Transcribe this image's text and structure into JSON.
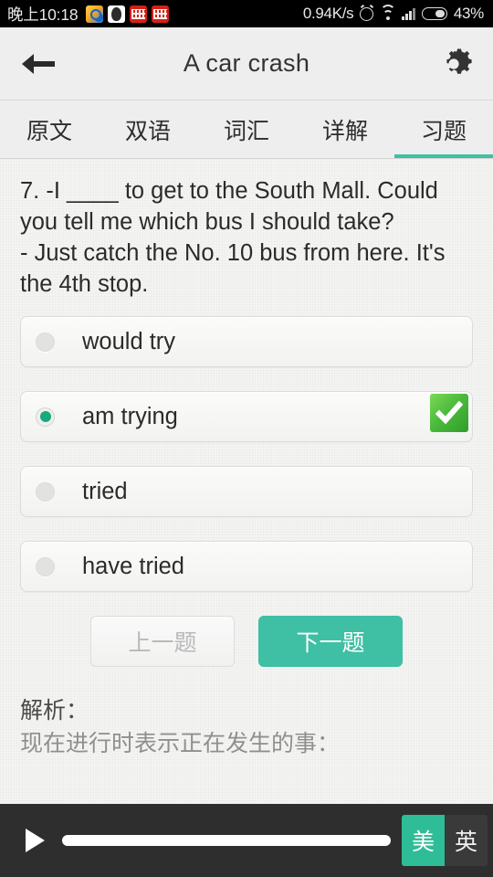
{
  "statusbar": {
    "clock": "晚上10:18",
    "app_icons": [
      "search-app-icon",
      "qq-app-icon",
      "red-app-icon-1",
      "red-app-icon-2"
    ],
    "network_speed": "0.94K/s",
    "icons": [
      "alarm-icon",
      "wifi-icon",
      "signal-icon",
      "battery-icon"
    ],
    "battery_percent": "43%"
  },
  "header": {
    "back_icon": "arrow-left-icon",
    "title": "A car crash",
    "settings_icon": "gear-icon"
  },
  "tabs": [
    {
      "label": "原文",
      "active": false
    },
    {
      "label": "双语",
      "active": false
    },
    {
      "label": "词汇",
      "active": false
    },
    {
      "label": "详解",
      "active": false
    },
    {
      "label": "习题",
      "active": true
    }
  ],
  "question": {
    "number": "7.",
    "text": "7. -I ____ to get to the South Mall. Could you tell me which bus I should take?\n- Just catch the No. 10 bus from here. It's the 4th stop."
  },
  "options": [
    {
      "label": "would try",
      "selected": false,
      "correct": false
    },
    {
      "label": "am trying",
      "selected": true,
      "correct": true
    },
    {
      "label": "tried",
      "selected": false,
      "correct": false
    },
    {
      "label": "have tried",
      "selected": false,
      "correct": false
    }
  ],
  "nav": {
    "prev_label": "上一题",
    "next_label": "下一题",
    "prev_disabled": true
  },
  "analysis": {
    "title": "解析：",
    "body": "现在进行时表示正在发生的事："
  },
  "player": {
    "play_icon": "play-icon",
    "progress_percent": 100,
    "accents": [
      {
        "label": "美",
        "active": true
      },
      {
        "label": "英",
        "active": false
      }
    ]
  },
  "colors": {
    "accent_teal": "#3fbfa3",
    "accent_teal_dark": "#2ebd97",
    "correct_green": "#4cbb3c",
    "radio_selected": "#18a97e",
    "header_bg": "#eeeeee",
    "content_bg": "#f4f4f2",
    "player_bg": "#2e2e2e",
    "statusbar_bg": "#000000"
  }
}
